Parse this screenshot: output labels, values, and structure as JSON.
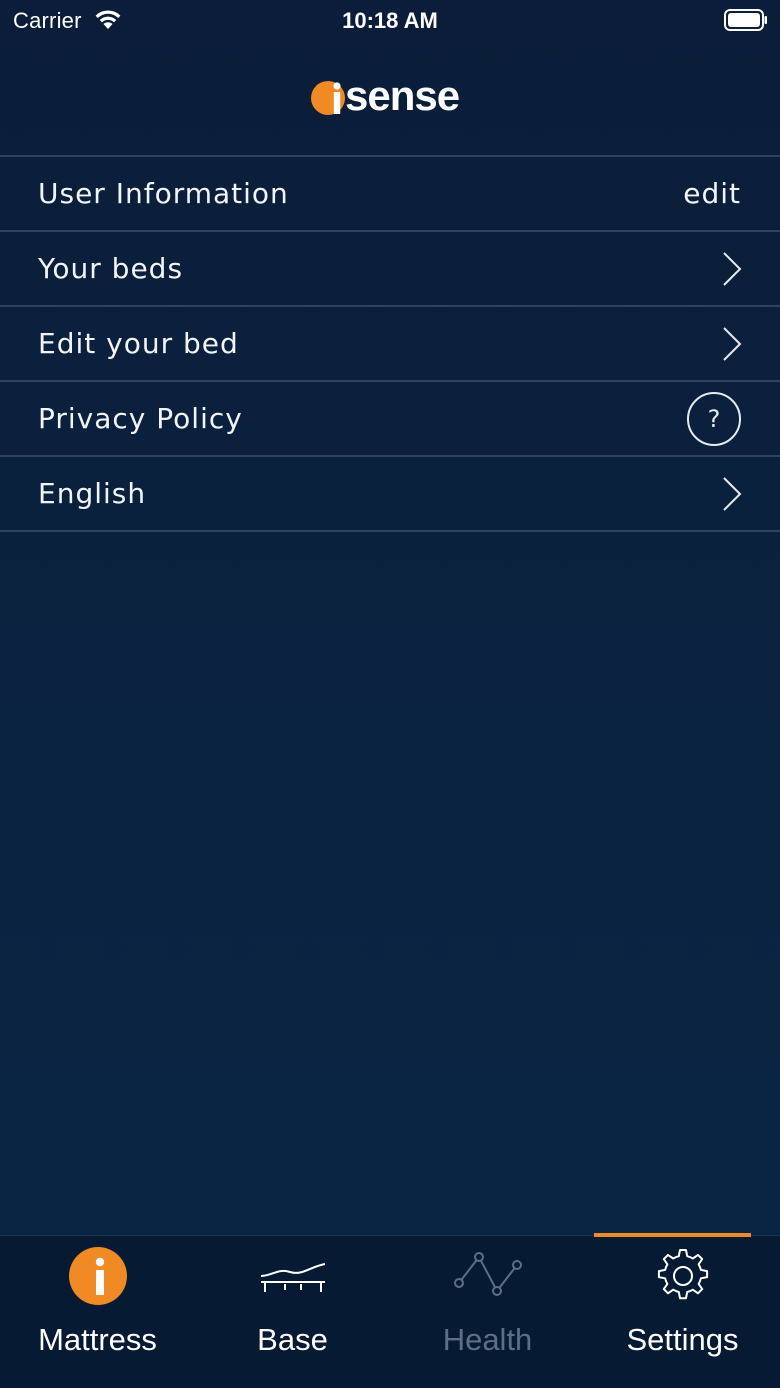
{
  "status_bar": {
    "carrier": "Carrier",
    "time": "10:18 AM"
  },
  "header": {
    "logo_text": "sense"
  },
  "settings": {
    "items": [
      {
        "label": "User Information",
        "action": "edit"
      },
      {
        "label": "Your beds"
      },
      {
        "label": "Edit your bed"
      },
      {
        "label": "Privacy Policy",
        "help_glyph": "?"
      },
      {
        "label": "English"
      }
    ]
  },
  "tab_bar": {
    "tabs": [
      {
        "label": "Mattress",
        "icon": "info-icon"
      },
      {
        "label": "Base",
        "icon": "adjustable-base-icon"
      },
      {
        "label": "Health",
        "icon": "health-graph-icon",
        "disabled": true
      },
      {
        "label": "Settings",
        "icon": "gear-icon",
        "active": true
      }
    ]
  },
  "colors": {
    "accent": "#f08a24",
    "background": "#0a2340",
    "divider": "#2d4461",
    "tab_inactive": "#5d6f86"
  }
}
